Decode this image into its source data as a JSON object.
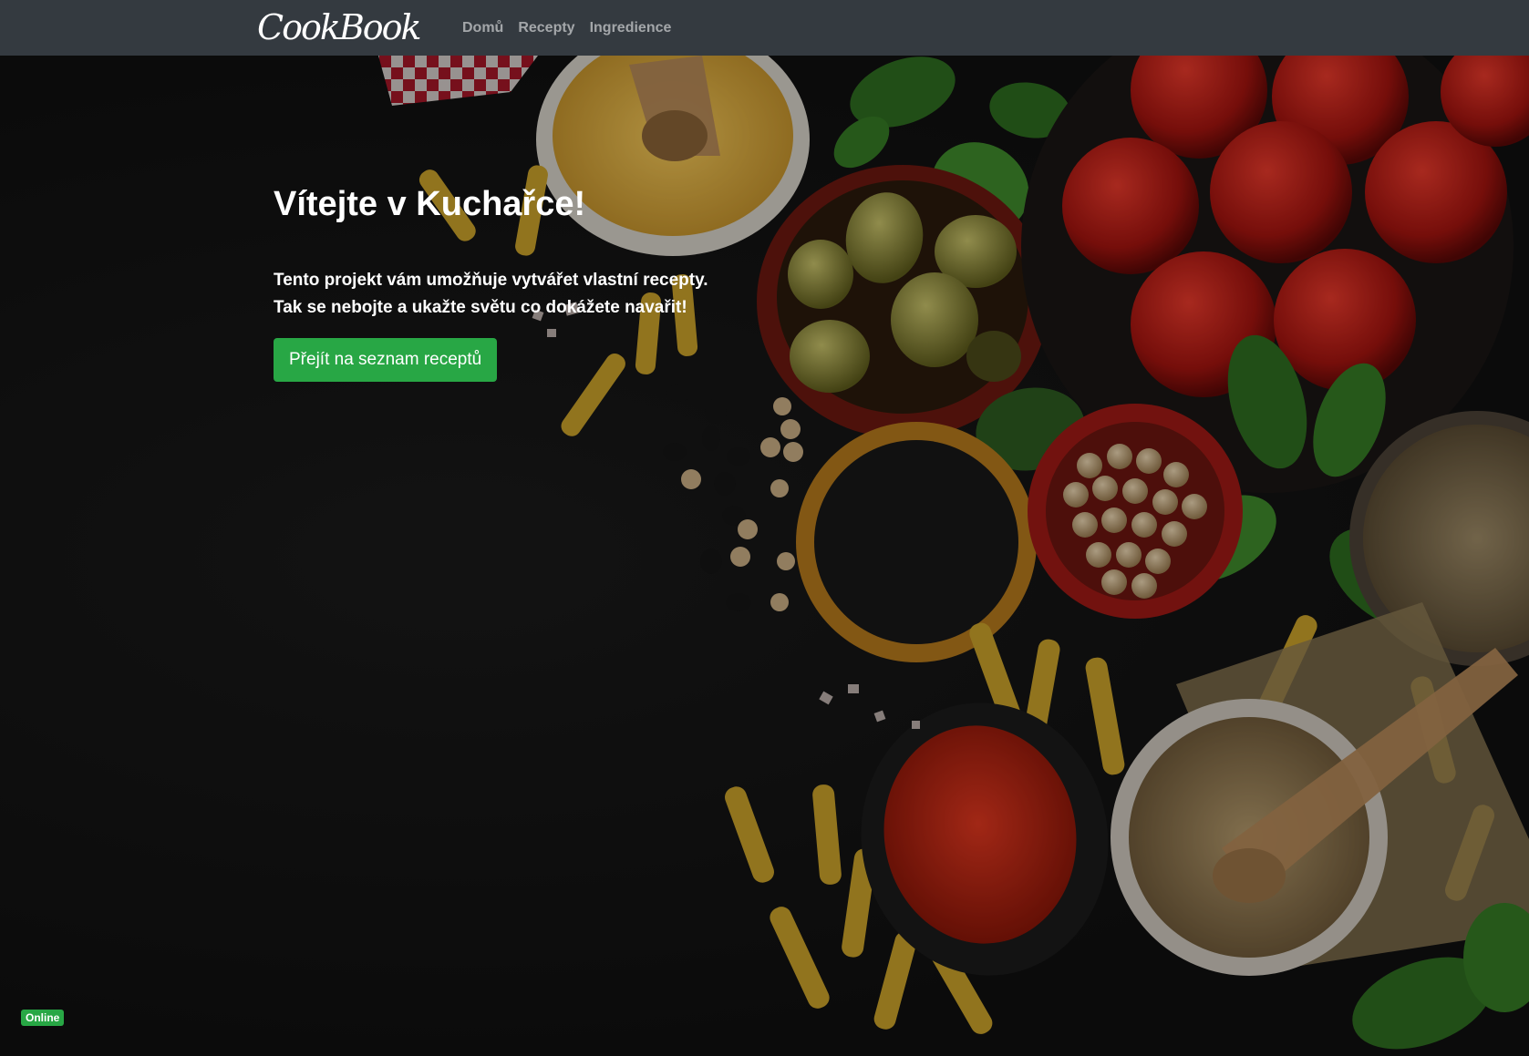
{
  "nav": {
    "brand": "CookBook",
    "links": [
      "Domů",
      "Recepty",
      "Ingredience"
    ]
  },
  "hero": {
    "title": "Vítejte v Kuchařce!",
    "line1": "Tento projekt vám umožňuje vytvářet vlastní recepty.",
    "line2": "Tak se nebojte a ukažte světu co dokážete navařit!",
    "button": "Přejít na seznam receptů"
  },
  "status": {
    "label": "Online"
  },
  "colors": {
    "navbar": "#343a40",
    "accent": "#28a745"
  }
}
